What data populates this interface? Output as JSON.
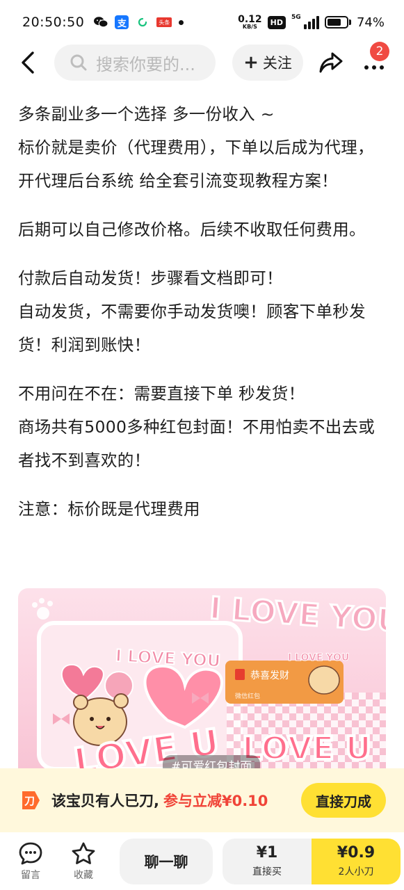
{
  "status_bar": {
    "time": "20:50:50",
    "net_speed": "0.12",
    "net_unit": "KB/S",
    "hd": "HD",
    "network": "5G",
    "battery": "74%",
    "battery_level": 0.74,
    "toutiao_label": "头条",
    "alipay_label": "支"
  },
  "nav": {
    "search_placeholder": "搜索你要的...",
    "follow_label": "关注",
    "notification_count": "2"
  },
  "description": {
    "paragraphs": [
      [
        "多条副业多一个选择 多一份收入 ~",
        "标价就是卖价（代理费用），下单以后成为代理，开代理后台系统 给全套引流变现教程方案！"
      ],
      [
        "后期可以自己修改价格。后续不收取任何费用。"
      ],
      [
        "付款后自动发货！步骤看文档即可！",
        "自动发货，不需要你手动发货噢！顾客下单秒发货！利润到账快！"
      ],
      [
        "不用问在不在：需要直接下单 秒发货！",
        "商场共有5000多种红包封面！不用怕卖不出去或者找不到喜欢的！"
      ],
      [
        "注意：标价既是代理费用"
      ]
    ]
  },
  "product_image": {
    "tag": "#可爱红包封面",
    "texts": {
      "big_title": "I LOVE YOU",
      "small_title": "I LOVE YOU",
      "badge_title": "I LOVE YOU",
      "envelope_greeting": "恭喜发财",
      "envelope_sub": "微信红包",
      "love_u_left": "LOVE U",
      "love_u_right": "LOVE U"
    }
  },
  "promo": {
    "text": "该宝贝有人已刀,",
    "highlight": "参与立减¥0.10",
    "button": "直接刀成",
    "icon_glyph": "刀"
  },
  "bottom_bar": {
    "message_label": "留言",
    "favorite_label": "收藏",
    "chat_label": "聊一聊",
    "buy_price": "¥1",
    "buy_label": "直接买",
    "group_price": "¥0.9",
    "group_label": "2人小刀"
  }
}
